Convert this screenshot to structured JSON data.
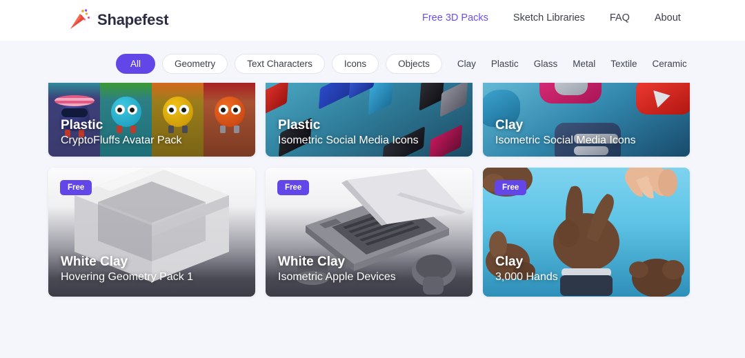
{
  "header": {
    "brand": "Shapefest",
    "logo_icon": "party-popper-icon",
    "nav": [
      {
        "label": "Free 3D Packs",
        "active": true
      },
      {
        "label": "Sketch Libraries",
        "active": false
      },
      {
        "label": "FAQ",
        "active": false
      },
      {
        "label": "About",
        "active": false
      }
    ]
  },
  "filters": {
    "pills": [
      {
        "label": "All",
        "active": true
      },
      {
        "label": "Geometry",
        "active": false
      },
      {
        "label": "Text Characters",
        "active": false
      },
      {
        "label": "Icons",
        "active": false
      },
      {
        "label": "Objects",
        "active": false
      }
    ],
    "materials": [
      "Clay",
      "Plastic",
      "Glass",
      "Metal",
      "Textile",
      "Ceramic"
    ]
  },
  "colors": {
    "accent_purple": "#6246e8",
    "nav_active": "#6b4ff0",
    "page_bg": "#f5f6fb",
    "header_bg": "#ffffff",
    "text_dark": "#2b2d42"
  },
  "cards": {
    "row1": [
      {
        "material": "Plastic",
        "name": "CryptoFluffs Avatar Pack",
        "badge": ""
      },
      {
        "material": "Plastic",
        "name": "Isometric Social Media Icons",
        "badge": ""
      },
      {
        "material": "Clay",
        "name": "Isometric Social Media Icons",
        "badge": ""
      }
    ],
    "row2": [
      {
        "material": "White Clay",
        "name": "Hovering Geometry Pack 1",
        "badge": "Free"
      },
      {
        "material": "White Clay",
        "name": "Isometric Apple Devices",
        "badge": "Free"
      },
      {
        "material": "Clay",
        "name": "3,000 Hands",
        "badge": "Free"
      }
    ]
  }
}
